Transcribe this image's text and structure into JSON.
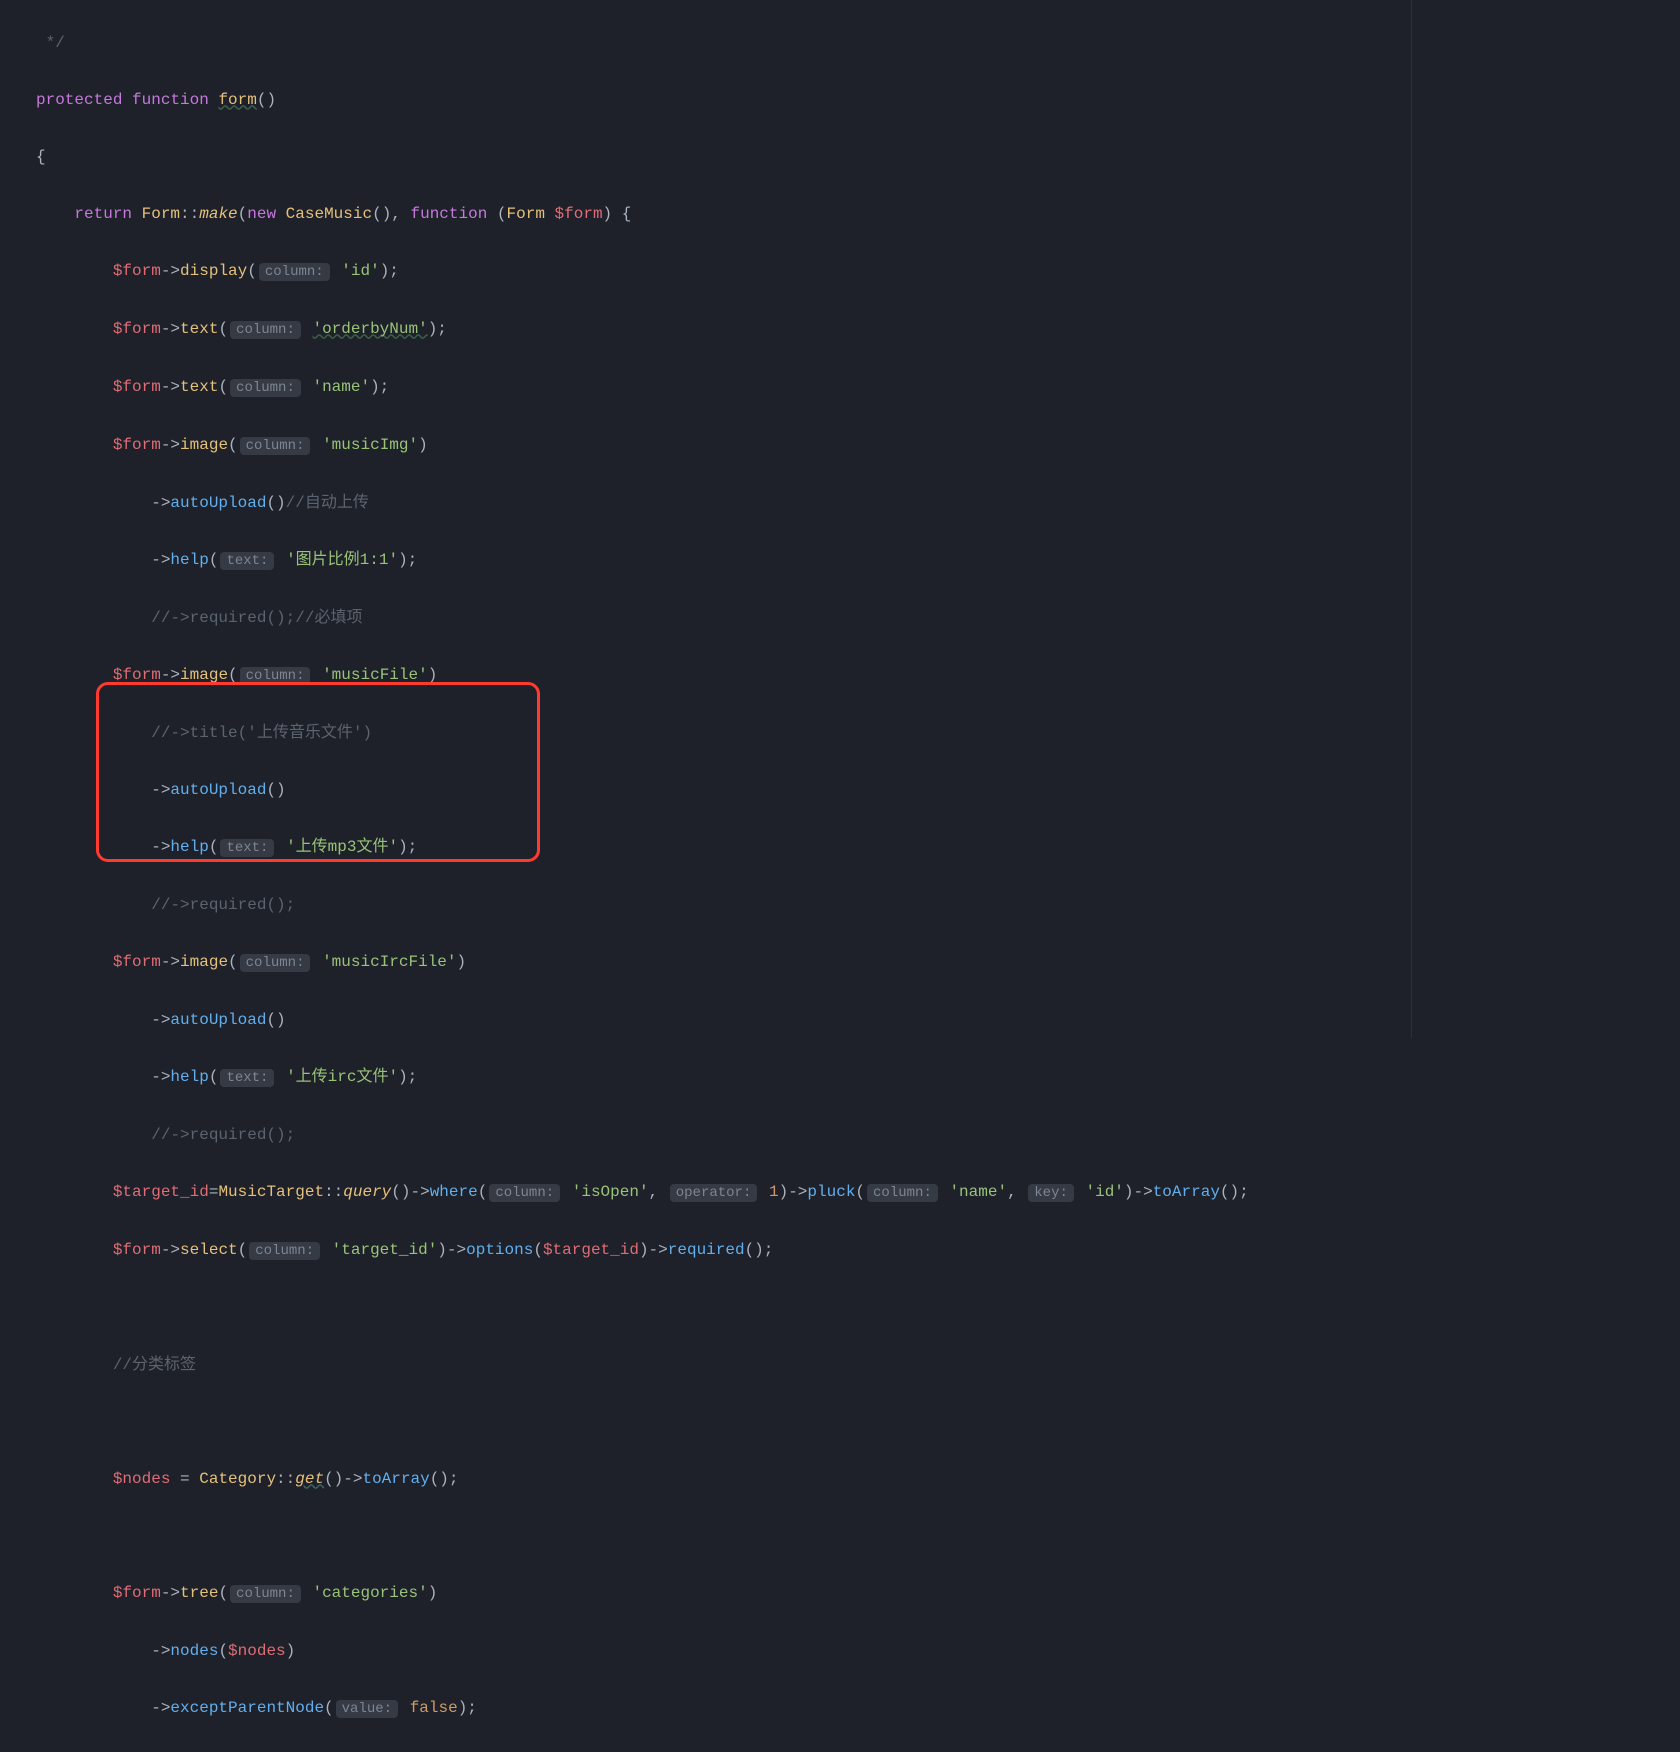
{
  "code": {
    "l1": " */",
    "l2_kw1": "protected",
    "l2_kw2": "function",
    "l2_fn": "form",
    "l2_p": "()",
    "l3": "{",
    "l4_kw": "return",
    "l4_cls": "Form",
    "l4_op": "::",
    "l4_make": "make",
    "l4_p1": "(",
    "l4_new": "new",
    "l4_cm": "CaseMusic",
    "l4_p2": "(), ",
    "l4_kw2": "function",
    "l4_p3": " (",
    "l4_ty": "Form",
    "l4_var": "$form",
    "l4_p4": ") {",
    "l5_v": "$form",
    "l5_a": "->",
    "l5_m": "display",
    "l5_p1": "(",
    "l5_h": "column:",
    "l5_s": "'id'",
    "l5_p2": ");",
    "l6_v": "$form",
    "l6_a": "->",
    "l6_m": "text",
    "l6_p1": "(",
    "l6_h": "column:",
    "l6_s": "'orderbyNum'",
    "l6_p2": ");",
    "l7_v": "$form",
    "l7_a": "->",
    "l7_m": "text",
    "l7_p1": "(",
    "l7_h": "column:",
    "l7_s": "'name'",
    "l7_p2": ");",
    "l8_v": "$form",
    "l8_a": "->",
    "l8_m": "image",
    "l8_p1": "(",
    "l8_h": "column:",
    "l8_s": "'musicImg'",
    "l8_p2": ")",
    "l9_a": "->",
    "l9_m": "autoUpload",
    "l9_p": "()",
    "l9_c": "//自动上传",
    "l10_a": "->",
    "l10_m": "help",
    "l10_p1": "(",
    "l10_h": "text:",
    "l10_s": "'图片比例1:1'",
    "l10_p2": ");",
    "l11_c": "//->required();//必填项",
    "l12_v": "$form",
    "l12_a": "->",
    "l12_m": "image",
    "l12_p1": "(",
    "l12_h": "column:",
    "l12_s": "'musicFile'",
    "l12_p2": ")",
    "l13_c": "//->title('上传音乐文件')",
    "l14_a": "->",
    "l14_m": "autoUpload",
    "l14_p": "()",
    "l15_a": "->",
    "l15_m": "help",
    "l15_p1": "(",
    "l15_h": "text:",
    "l15_s": "'上传mp3文件'",
    "l15_p2": ");",
    "l16_c": "//->required();",
    "l17_v": "$form",
    "l17_a": "->",
    "l17_m": "image",
    "l17_p1": "(",
    "l17_h": "column:",
    "l17_s": "'musicIrcFile'",
    "l17_p2": ")",
    "l18_a": "->",
    "l18_m": "autoUpload",
    "l18_p": "()",
    "l19_a": "->",
    "l19_m": "help",
    "l19_p1": "(",
    "l19_h": "text:",
    "l19_s": "'上传irc文件'",
    "l19_p2": ");",
    "l20_c": "//->required();",
    "l21_v": "$target_id",
    "l21_e": "=",
    "l21_cls": "MusicTarget",
    "l21_op": "::",
    "l21_q": "query",
    "l21_p1": "()->",
    "l21_w": "where",
    "l21_p2": "(",
    "l21_h1": "column:",
    "l21_s1": "'isOpen'",
    "l21_c1": ", ",
    "l21_h2": "operator:",
    "l21_n": "1",
    "l21_p3": ")->",
    "l21_pk": "pluck",
    "l21_p4": "(",
    "l21_h3": "column:",
    "l21_s2": "'name'",
    "l21_c2": ", ",
    "l21_h4": "key:",
    "l21_s3": "'id'",
    "l21_p5": ")->",
    "l21_ta": "toArray",
    "l21_p6": "();",
    "l22_v": "$form",
    "l22_a": "->",
    "l22_m": "select",
    "l22_p1": "(",
    "l22_h": "column:",
    "l22_s": "'target_id'",
    "l22_p2": ")->",
    "l22_o": "options",
    "l22_p3": "(",
    "l22_v2": "$target_id",
    "l22_p4": ")->",
    "l22_r": "required",
    "l22_p5": "();",
    "l24_c": "//分类标签",
    "l26_v": "$nodes",
    "l26_e": " = ",
    "l26_cls": "Category",
    "l26_op": "::",
    "l26_g": "get",
    "l26_p1": "()->",
    "l26_ta": "toArray",
    "l26_p2": "();",
    "l28_v": "$form",
    "l28_a": "->",
    "l28_m": "tree",
    "l28_p1": "(",
    "l28_h": "column:",
    "l28_s": "'categories'",
    "l28_p2": ")",
    "l29_a": "->",
    "l29_m": "nodes",
    "l29_p1": "(",
    "l29_v": "$nodes",
    "l29_p2": ")",
    "l30_a": "->",
    "l30_m": "exceptParentNode",
    "l30_p1": "(",
    "l30_h": "value:",
    "l30_c": "false",
    "l30_p2": ");"
  }
}
